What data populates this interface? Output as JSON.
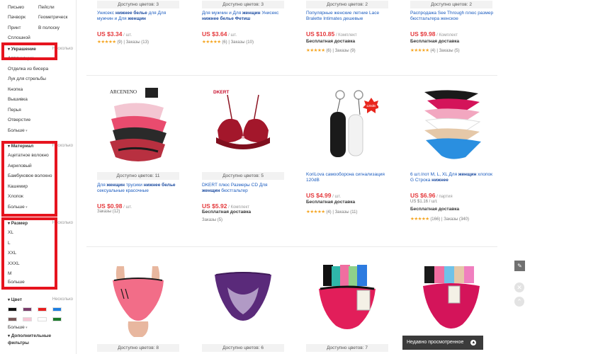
{
  "sidebar": {
    "top_grid": [
      [
        "Письмо",
        "Пейсли"
      ],
      [
        "Пачворк",
        "Геометрическ"
      ],
      [
        "Принт",
        "В полоску"
      ],
      [
        "Сплошной",
        ""
      ]
    ],
    "decoration": {
      "title": "Украшение",
      "more_right": "Несколько",
      "items": [
        "Аппликации",
        "Отделка из бисера",
        "Лук для стрельбы",
        "Кнопка",
        "Вышивка",
        "Перья",
        "Отверстие"
      ],
      "more": "Больше"
    },
    "material": {
      "title": "Материал",
      "more_right": "Несколько",
      "items": [
        "Ацетатное волокно",
        "Акриловый",
        "Бамбуковое волокно",
        "Кашемир",
        "Хлопок"
      ],
      "more": "Больше"
    },
    "size": {
      "title": "Размер",
      "more_right": "Несколько",
      "items": [
        "XL",
        "L",
        "XXL",
        "XXXL",
        "M",
        "Больше"
      ]
    },
    "color": {
      "title": "Цвет",
      "more_right": "Несколько",
      "swatches": [
        "#111111",
        "#7a3d6b",
        "#e81f1f",
        "#1e7fe0",
        "#7b5a5a",
        "#f7c6d6",
        "#ffffff",
        "#1a7a2a"
      ],
      "more": "Больше",
      "extra_filters": "Дополнительные фильтры"
    }
  },
  "row1": [
    {
      "avail": "Доступно цветов: 3",
      "title_pre": "Унисекс ",
      "title_bold": "нижнее белье",
      "title_post": " для Для мужчин и Для ",
      "title_bold2": "женщин",
      "price": "US $3.34",
      "unit": " / шт.",
      "stars": "★★★★★",
      "reviews": "(9)",
      "orders": "Заказы (13)"
    },
    {
      "avail": "Доступно цветов: 3",
      "title_pre": "Для мужчин и Для ",
      "title_bold": "женщин",
      "title_post": " Унисекс ",
      "title_bold2": "нижнее белье Фетиш",
      "price": "US $3.64",
      "unit": " / шт.",
      "stars": "★★★★★",
      "reviews": "(6)",
      "orders": "Заказы (10)"
    },
    {
      "avail": "Доступно цветов: 2",
      "title_pre": "Популярные женские летние Lace Bralette Intimates дешевые",
      "title_bold": "",
      "title_post": "",
      "title_bold2": "",
      "price": "US $10.85",
      "unit": " / Комплект",
      "ship": "Бесплатная доставка",
      "stars": "★★★★★",
      "reviews": "(6)",
      "orders": "Заказы (9)"
    },
    {
      "avail": "Доступно цветов: 2",
      "title_pre": "Распродажа See Through плюс размер бюстгальтера женское",
      "title_bold": "",
      "title_post": "",
      "title_bold2": "",
      "price": "US $9.98",
      "unit": " / Комплект",
      "ship": "Бесплатная доставка",
      "stars": "★★★★★",
      "reviews": "(4)",
      "orders": "Заказы (5)"
    }
  ],
  "row2": [
    {
      "avail": "Доступно цветов: 11",
      "brand": "ARCENENO",
      "title_pre": "Для ",
      "title_bold": "женщин",
      "title_post": " трусики ",
      "title_bold2": "нижнее белье",
      "title_end": " сексуальные красочные",
      "price": "US $0.98",
      "unit": " / шт.",
      "orders": "Заказы (12)"
    },
    {
      "avail": "Доступно цветов: 5",
      "brand": "DKERT",
      "title_pre": "DKERT плюс Размеры CD Для ",
      "title_bold": "женщин",
      "title_post": " бюстгальтер ",
      "title_bold2": "",
      "title_end": "",
      "price": "US $5.92",
      "unit": " / Комплект",
      "ship": "Бесплатная доставка",
      "orders": "Заказы (5)"
    },
    {
      "avail": "",
      "brand": "120dB",
      "title_pre": "KoriLova самооборона сигнализация 120dB",
      "title_bold": "",
      "title_post": "",
      "title_bold2": "",
      "title_end": "",
      "price": "US $4.99",
      "unit": " / шт.",
      "ship": "Бесплатная доставка",
      "stars": "★★★★★",
      "reviews": "(4)",
      "orders": "Заказы (11)"
    },
    {
      "avail": "",
      "brand": "",
      "title_pre": "6 шт./лот M, L, XL Для ",
      "title_bold": "женщин",
      "title_post": " хлопок G Строка ",
      "title_bold2": "нижнее",
      "title_end": "",
      "price": "US $6.96",
      "unit": " / партия",
      "unit2": "US $1.16 / шт.",
      "ship": "Бесплатная доставка",
      "stars": "★★★★★",
      "reviews": "(166)",
      "orders": "Заказы (340)"
    }
  ],
  "row3": [
    {
      "avail": "Доступно цветов: 8"
    },
    {
      "avail": "Доступно цветов: 6"
    },
    {
      "avail": "Доступно цветов: 7"
    },
    {
      "avail": ""
    }
  ],
  "overlay": {
    "recently_viewed": "Недавно просмотренное",
    "edit_icon": "pencil-icon",
    "close_icon": "close-icon",
    "up_icon": "chevron-up-icon"
  }
}
